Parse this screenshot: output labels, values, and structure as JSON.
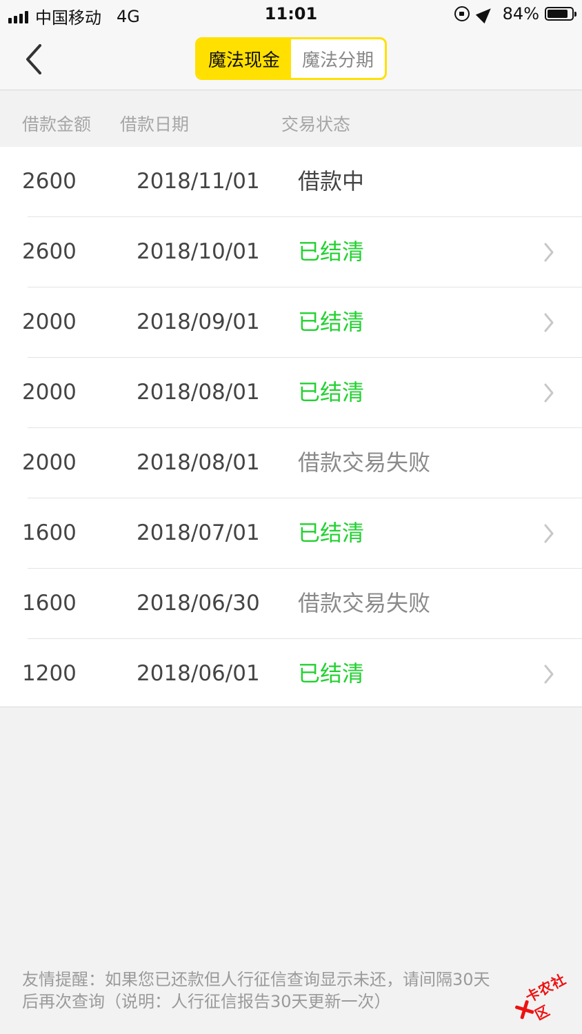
{
  "status_bar": {
    "carrier": "中国移动",
    "network": "4G",
    "time": "11:01",
    "battery": "84%",
    "battery_level": 0.84
  },
  "nav": {
    "tabs": [
      {
        "label": "魔法现金",
        "active": true
      },
      {
        "label": "魔法分期",
        "active": false
      }
    ]
  },
  "table": {
    "headers": [
      "借款金额",
      "借款日期",
      "交易状态"
    ],
    "rows": [
      {
        "amount": "2600",
        "date": "2018/11/01",
        "status": "借款中",
        "status_kind": "pending",
        "has_detail": false
      },
      {
        "amount": "2600",
        "date": "2018/10/01",
        "status": "已结清",
        "status_kind": "settled",
        "has_detail": true
      },
      {
        "amount": "2000",
        "date": "2018/09/01",
        "status": "已结清",
        "status_kind": "settled",
        "has_detail": true
      },
      {
        "amount": "2000",
        "date": "2018/08/01",
        "status": "已结清",
        "status_kind": "settled",
        "has_detail": true
      },
      {
        "amount": "2000",
        "date": "2018/08/01",
        "status": "借款交易失败",
        "status_kind": "failed",
        "has_detail": false
      },
      {
        "amount": "1600",
        "date": "2018/07/01",
        "status": "已结清",
        "status_kind": "settled",
        "has_detail": true
      },
      {
        "amount": "1600",
        "date": "2018/06/30",
        "status": "借款交易失败",
        "status_kind": "failed",
        "has_detail": false
      },
      {
        "amount": "1200",
        "date": "2018/06/01",
        "status": "已结清",
        "status_kind": "settled",
        "has_detail": true
      }
    ]
  },
  "footer": {
    "line1": "友情提醒：如果您已还款但人行征信查询显示未还，请间隔30天",
    "line2": "后再次查询（说明：人行征信报告30天更新一次）"
  },
  "watermark": {
    "text": "卡农社区"
  },
  "colors": {
    "accent": "#ffe000",
    "settled": "#22d130",
    "pending": "#444444",
    "failed": "#8a8a8a",
    "chevron": "#c7c7c7"
  },
  "icons": {
    "back": "back-arrow-icon",
    "row_detail": "chevron-right-icon"
  }
}
